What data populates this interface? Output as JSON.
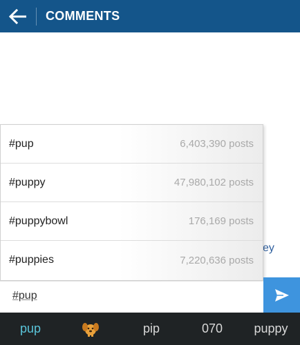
{
  "header": {
    "title": "COMMENTS",
    "background": "#14558a"
  },
  "content": {
    "partial_text": "ey"
  },
  "suggestions": [
    {
      "tag": "#pup",
      "count": "6,403,390 posts"
    },
    {
      "tag": "#puppy",
      "count": "47,980,102 posts"
    },
    {
      "tag": "#puppybowl",
      "count": "176,169 posts"
    },
    {
      "tag": "#puppies",
      "count": "7,220,636 posts"
    }
  ],
  "composer": {
    "input_value": "#pup",
    "send_icon": "send-icon",
    "send_color": "#3e94de"
  },
  "keyboard": {
    "suggestions": [
      "pup",
      "dog-emoji",
      "pip",
      "070",
      "puppy"
    ],
    "active_color": "#5ac4d9"
  }
}
